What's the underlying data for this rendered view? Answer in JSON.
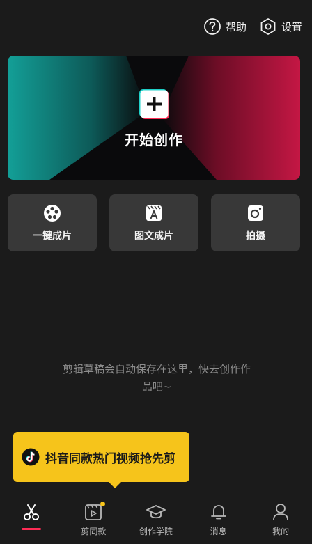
{
  "header": {
    "help_label": "帮助",
    "settings_label": "设置",
    "help_icon": "question-circle-icon",
    "settings_icon": "hexagon-gear-icon"
  },
  "hero": {
    "title": "开始创作",
    "icon": "plus-icon",
    "colors": {
      "left": "#0f8f8a",
      "right": "#c4143f"
    }
  },
  "quick_actions": [
    {
      "label": "一键成片",
      "icon": "film-reel-icon"
    },
    {
      "label": "图文成片",
      "icon": "text-clip-icon"
    },
    {
      "label": "拍摄",
      "icon": "camera-icon"
    }
  ],
  "empty_state": {
    "line1": "剪辑草稿会自动保存在这里，快去创作作",
    "line2": "品吧~"
  },
  "promo": {
    "text": "抖音同款热门视频抢先剪",
    "icon": "douyin-logo-icon",
    "color": "#f6c41b"
  },
  "tabs": [
    {
      "label": "",
      "icon": "scissors-icon",
      "active": true
    },
    {
      "label": "剪同款",
      "icon": "template-video-icon",
      "badge": true
    },
    {
      "label": "创作学院",
      "icon": "graduation-cap-icon"
    },
    {
      "label": "消息",
      "icon": "bell-icon"
    },
    {
      "label": "我的",
      "icon": "person-icon"
    }
  ],
  "accent": "#fe2c55"
}
